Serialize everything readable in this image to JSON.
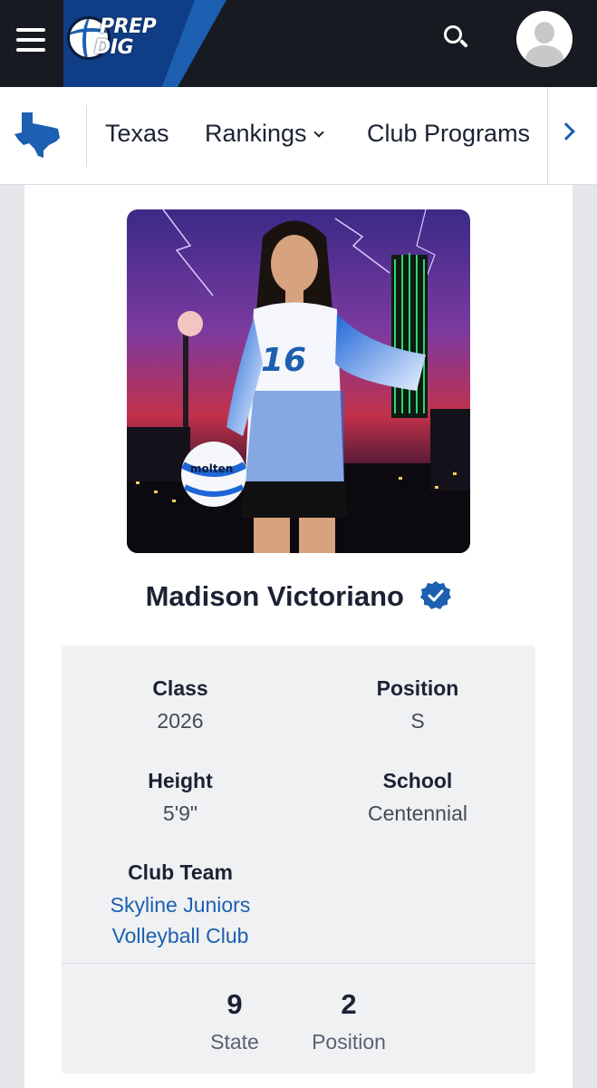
{
  "header": {
    "logo_line1": "PREP",
    "logo_line2": "DIG"
  },
  "subnav": {
    "items": [
      {
        "label": "Texas"
      },
      {
        "label": "Rankings"
      },
      {
        "label": "Club Programs"
      }
    ]
  },
  "player": {
    "name": "Madison Victoriano",
    "jersey_number": "16",
    "ball_brand": "molten"
  },
  "details": {
    "class_label": "Class",
    "class_value": "2026",
    "position_label": "Position",
    "position_value": "S",
    "height_label": "Height",
    "height_value": "5'9\"",
    "school_label": "School",
    "school_value": "Centennial",
    "club_label": "Club Team",
    "club_line1": "Skyline Juniors",
    "club_line2": "Volleyball Club"
  },
  "rankings": [
    {
      "value": "9",
      "label": "State"
    },
    {
      "value": "2",
      "label": "Position"
    }
  ],
  "colors": {
    "brand_blue": "#1d5fb0",
    "header_bg": "#171a20",
    "text_dark": "#1b2233"
  },
  "icons": [
    "hamburger-menu-icon",
    "search-icon",
    "user-avatar-icon",
    "texas-state-icon",
    "chevron-down-icon",
    "chevron-right-icon",
    "verified-badge-icon"
  ]
}
